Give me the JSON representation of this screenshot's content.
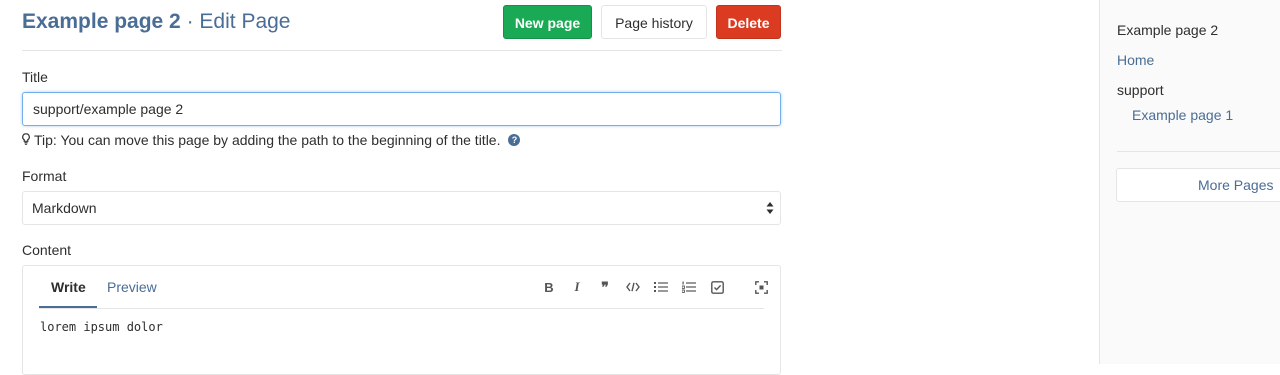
{
  "header": {
    "page_name": "Example page 2",
    "separator": " · ",
    "subtitle": "Edit Page",
    "buttons": {
      "new_page": "New page",
      "page_history": "Page history",
      "delete": "Delete"
    }
  },
  "form": {
    "title_label": "Title",
    "title_value": "support/example page 2",
    "tip_text": "Tip: You can move this page by adding the path to the beginning of the title.",
    "format_label": "Format",
    "format_value": "Markdown",
    "content_label": "Content",
    "tabs": {
      "write": "Write",
      "preview": "Preview"
    },
    "toolbar": {
      "bold": "B",
      "italic": "I",
      "quote": "❞",
      "code": "</>",
      "bullet_list": "list",
      "numbered_list": "ordered-list",
      "task_list": "task-list",
      "fullscreen": "fullscreen"
    },
    "content_value": "lorem ipsum dolor"
  },
  "sidebar": {
    "current_page": "Example page 2",
    "home": "Home",
    "group": "support",
    "child_page": "Example page 1",
    "more_pages": "More Pages"
  },
  "colors": {
    "accent": "#4a6d96",
    "green": "#1aaa55",
    "red": "#db3b21",
    "border": "#e5e5e5"
  }
}
